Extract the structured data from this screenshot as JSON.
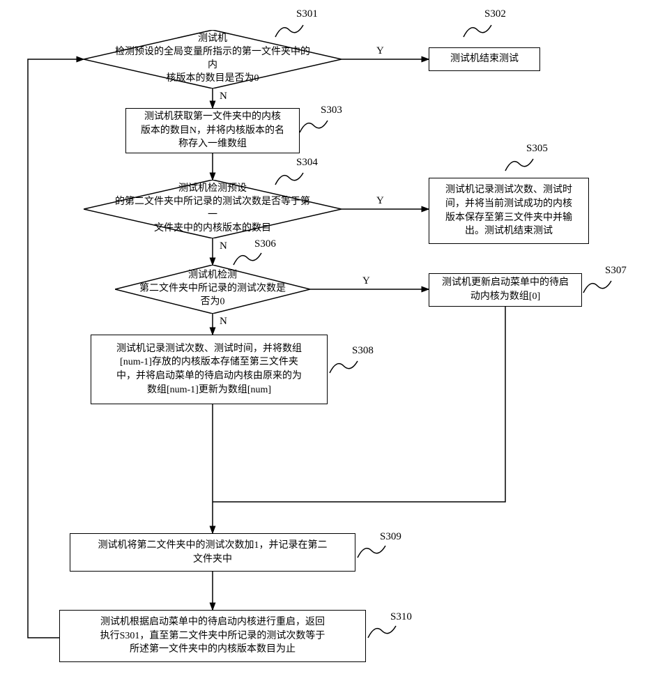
{
  "labels": {
    "s301": "S301",
    "s302": "S302",
    "s303": "S303",
    "s304": "S304",
    "s305": "S305",
    "s306": "S306",
    "s307": "S307",
    "s308": "S308",
    "s309": "S309",
    "s310": "S310"
  },
  "yn": {
    "y": "Y",
    "n": "N"
  },
  "nodes": {
    "s301": "测试机\n检测预设的全局变量所指示的第一文件夹中的内\n核版本的数目是否为0",
    "s302": "测试机结束测试",
    "s303": "测试机获取第一文件夹中的内核\n版本的数目N，并将内核版本的名\n称存入一维数组",
    "s304": "测试机检测预设\n的第二文件夹中所记录的测试次数是否等于第一\n文件夹中的内核版本的数目",
    "s305": "测试机记录测试次数、测试时\n间，并将当前测试成功的内核\n版本保存至第三文件夹中并输\n出。测试机结束测试",
    "s306": "测试机检测\n第二文件夹中所记录的测试次数是\n否为0",
    "s307": "测试机更新启动菜单中的待启\n动内核为数组[0]",
    "s308": "测试机记录测试次数、测试时间，并将数组\n[num-1]存放的内核版本存储至第三文件夹\n中，并将启动菜单的待启动内核由原来的为\n数组[num-1]更新为数组[num]",
    "s309": "测试机将第二文件夹中的测试次数加1，并记录在第二\n文件夹中",
    "s310": "测试机根据启动菜单中的待启动内核进行重启，返回\n执行S301，直至第二文件夹中所记录的测试次数等于\n所述第一文件夹中的内核版本数目为止"
  }
}
